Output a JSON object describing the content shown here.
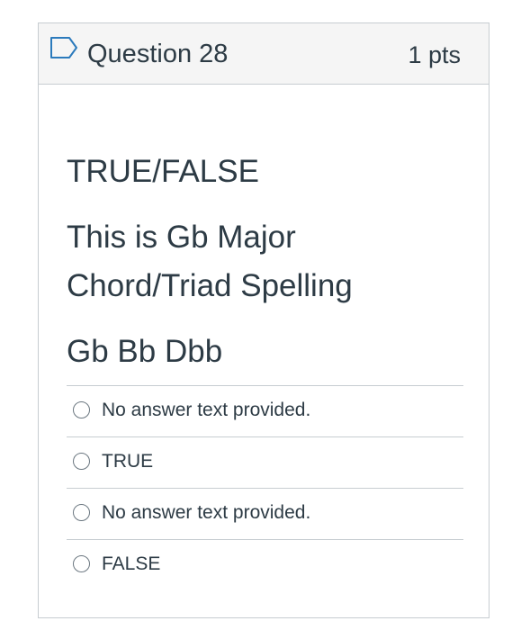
{
  "question": {
    "title": "Question 28",
    "points": "1 pts",
    "flag_icon": "flag-outline-icon",
    "lines": [
      "TRUE/FALSE",
      "This is Gb Major",
      "Chord/Triad Spelling",
      "Gb Bb Dbb"
    ]
  },
  "answers": [
    {
      "label": "No answer text provided.",
      "selected": false
    },
    {
      "label": "TRUE",
      "selected": false
    },
    {
      "label": "No answer text provided.",
      "selected": false
    },
    {
      "label": "FALSE",
      "selected": false
    }
  ],
  "colors": {
    "text": "#2d3b45",
    "border": "#c7cdd1",
    "header_bg": "#f5f5f5",
    "flag_stroke": "#2b7abc"
  }
}
